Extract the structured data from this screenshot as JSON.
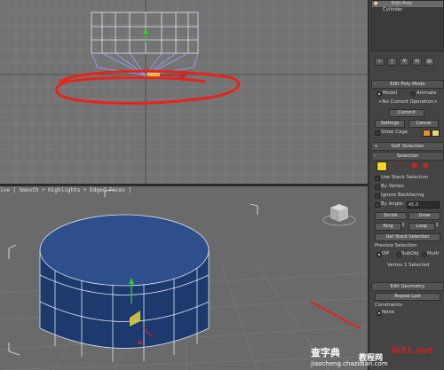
{
  "viewport": {
    "label": "ive [ Smooth + Highlights + Edged Faces ]"
  },
  "panel": {
    "modifier_stack": {
      "items": [
        "Edit Poly",
        "Cylinder"
      ]
    },
    "edit_poly_mode": {
      "title": "Edit Poly Mode",
      "model": "Model",
      "animate": "Animate",
      "operation": "<No Current Operation>",
      "commit": "Commit",
      "settings": "Settings",
      "cancel": "Cancel",
      "show_cage": "Show Cage"
    },
    "soft_selection": {
      "title": "Soft Selection"
    },
    "selection": {
      "title": "Selection",
      "use_stack": "Use Stack Selection",
      "by_vertex": "By Vertex",
      "ignore_backfacing": "Ignore Backfacing",
      "by_angle": "By Angle:",
      "angle_value": "45.0",
      "shrink": "Shrink",
      "grow": "Grow",
      "ring": "Ring",
      "loop": "Loop",
      "get_stack": "Get Stack Selection",
      "preview": "Preview Selection",
      "off": "Off",
      "subobj": "SubObj",
      "multi": "Multi",
      "status": "Vertex 1 Selected"
    },
    "edit_geometry": {
      "title": "Edit Geometry",
      "repeat_last": "Repeat Last",
      "constraints": "Constraints",
      "none": "None"
    }
  },
  "watermark": {
    "line1": "查字典",
    "line2": "教程网",
    "site": "ib51.net",
    "url": "jiaocheng.chazidian.com"
  },
  "colors": {
    "viewport_grid": "#8c8c8c",
    "cylinder_fill": "#1d3a6e",
    "red_annotation": "#e8221c",
    "cage_orange": "#e8902a",
    "vertex_red": "#cc2020",
    "selection_yellow": "#e8d43a"
  }
}
